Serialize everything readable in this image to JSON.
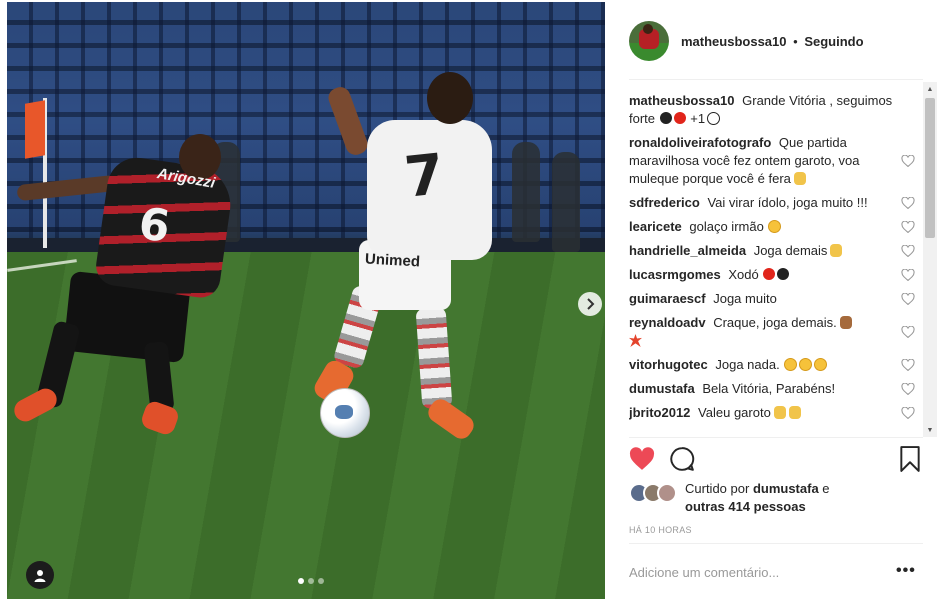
{
  "post": {
    "username": "matheusbossa10",
    "separator": "•",
    "follow_status": "Seguindo"
  },
  "photo": {
    "player_left_number": "6",
    "player_left_sponsor": "Arigozzi",
    "player_right_number": "7",
    "player_right_sponsor": "Unimed",
    "carousel_count": 3,
    "carousel_active": 1
  },
  "caption": {
    "author": "matheusbossa10",
    "text": "Grande Vitória , seguimos forte",
    "suffix": "+1"
  },
  "comments": [
    {
      "author": "ronaldoliveirafotografo",
      "text": "Que partida maravilhosa você fez ontem garoto, voa muleque porque você é fera",
      "emoji": "hand"
    },
    {
      "author": "sdfrederico",
      "text": "Vai virar ídolo, joga muito !!!",
      "emoji": ""
    },
    {
      "author": "learicete",
      "text": "golaço irmão",
      "emoji": "grin"
    },
    {
      "author": "handrielle_almeida",
      "text": "Joga demais",
      "emoji": "hand"
    },
    {
      "author": "lucasrmgomes",
      "text": "Xodó",
      "emoji": "redblack"
    },
    {
      "author": "guimaraescf",
      "text": "Joga muito",
      "emoji": ""
    },
    {
      "author": "reynaldoadv",
      "text": "Craque, joga demais.",
      "emoji": "fist-burst"
    },
    {
      "author": "vitorhugotec",
      "text": "Joga nada.",
      "emoji": "laugh3"
    },
    {
      "author": "dumustafa",
      "text": "Bela Vitória, Parabéns!",
      "emoji": ""
    },
    {
      "author": "jbrito2012",
      "text": "Valeu garoto",
      "emoji": "thumbs2"
    }
  ],
  "likes": {
    "prefix": "Curtido por",
    "user": "dumustafa",
    "and": "e",
    "others": "outras 414 pessoas"
  },
  "timestamp": "HÁ 10 HORAS",
  "comment_input": {
    "placeholder": "Adicione um comentário..."
  },
  "more_label": "•••",
  "colors": {
    "heart_red": "#ed4956",
    "text": "#262626",
    "muted": "#999999",
    "divider": "#efefef"
  },
  "icons": [
    "next-arrow-icon",
    "user-tag-icon",
    "heart-icon",
    "comment-icon",
    "bookmark-icon",
    "more-icon"
  ]
}
